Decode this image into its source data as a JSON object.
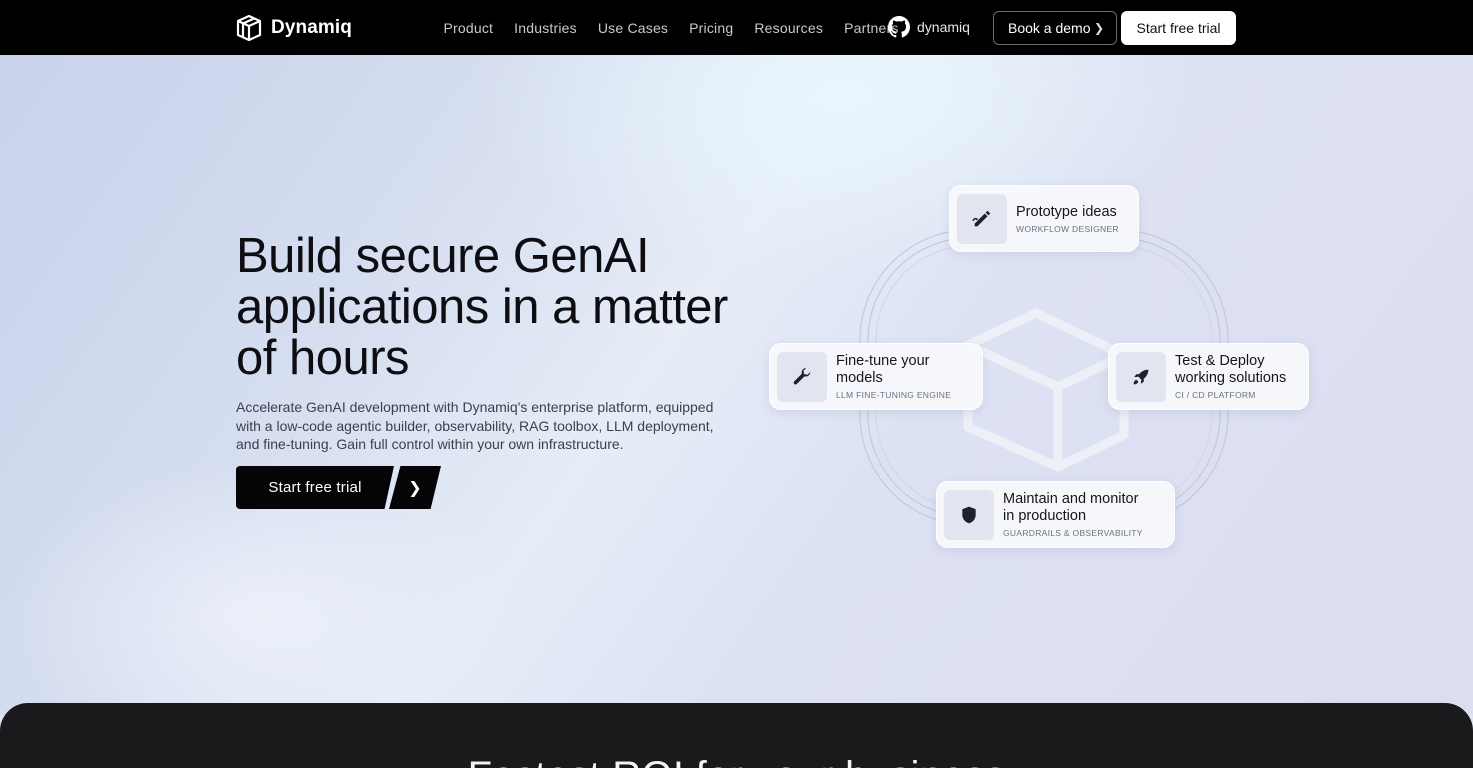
{
  "brand": {
    "name": "Dynamiq"
  },
  "nav": {
    "items": [
      "Product",
      "Industries",
      "Use Cases",
      "Pricing",
      "Resources",
      "Partners"
    ],
    "github_label": "dynamiq",
    "demo_label": "Book a demo",
    "trial_label": "Start free trial"
  },
  "hero": {
    "title_lines": [
      "Build secure GenAI",
      "applications in a matter",
      "of hours"
    ],
    "description": "Accelerate GenAI development with Dynamiq's enterprise platform, equipped with a low-code agentic builder, observability, RAG toolbox, LLM deployment, and fine-tuning. Gain full control within your own infrastructure.",
    "cta_label": "Start free trial"
  },
  "cards": [
    {
      "title": "Prototype ideas",
      "subtitle": "WORKFLOW DESIGNER",
      "icon": "pen-icon"
    },
    {
      "title": "Fine-tune your models",
      "subtitle": "LLM FINE-TUNING ENGINE",
      "icon": "wrench-icon"
    },
    {
      "title": "Test & Deploy working solutions",
      "subtitle": "CI / CD PLATFORM",
      "icon": "rocket-icon"
    },
    {
      "title": "Maintain and monitor in production",
      "subtitle": "GUARDRAILS & OBSERVABILITY",
      "icon": "shield-icon"
    }
  ],
  "section2": {
    "title": "Fastest ROI for your business"
  }
}
